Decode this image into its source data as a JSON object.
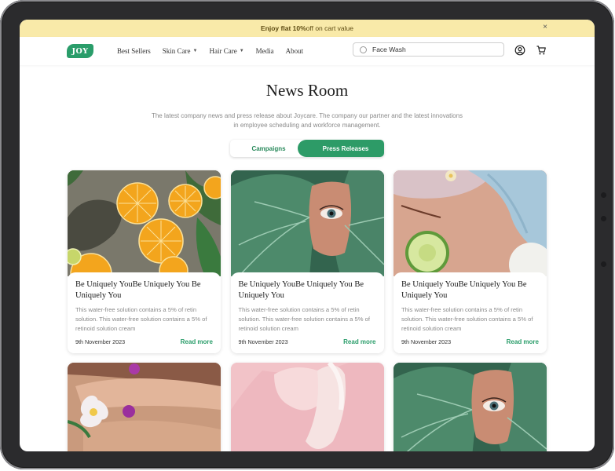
{
  "promo": {
    "bold": "Enjoy flat 10%",
    "rest": " off on cart value",
    "close": "×"
  },
  "nav": {
    "logo": "JOY",
    "menu": [
      {
        "label": "Best Sellers"
      },
      {
        "label": "Skin Care"
      },
      {
        "label": "Hair Care"
      },
      {
        "label": "Media"
      },
      {
        "label": "About"
      }
    ],
    "search_value": "Face Wash",
    "icons": [
      "search-icon",
      "user-icon",
      "cart-icon"
    ]
  },
  "hero": {
    "title": "News Room",
    "subtitle_1": "The latest company news and press release about Joycare. The company our partner and the latest innovations",
    "subtitle_2": "in employee scheduling and workforce management."
  },
  "tabs": {
    "campaigns": "Campaigns",
    "press": "Press Releases"
  },
  "cards": [
    {
      "title": "Be Uniquely YouBe Uniquely You Be Uniquely You",
      "text": "This water-free solution contains a 5% of retin solution. This water-free solution contains a 5% of retinoid solution cream",
      "date": "9th November 2023",
      "cta": "Read more",
      "image": "citrus slices in water"
    },
    {
      "title": "Be Uniquely YouBe Uniquely You Be Uniquely You",
      "text": "This water-free solution contains a 5% of retin solution. This water-free solution contains a 5% of retinoid solution cream",
      "date": "9th November 2023",
      "cta": "Read more",
      "image": "eye through leaf"
    },
    {
      "title": "Be Uniquely YouBe Uniquely You Be Uniquely You",
      "text": "This water-free solution contains a 5% of retin solution. This water-free solution contains a 5% of retinoid solution cream",
      "date": "9th November 2023",
      "cta": "Read more",
      "image": "spa cucumber"
    }
  ],
  "colors": {
    "accent": "#2d9b67",
    "promo_bg": "#f9eaa9"
  }
}
